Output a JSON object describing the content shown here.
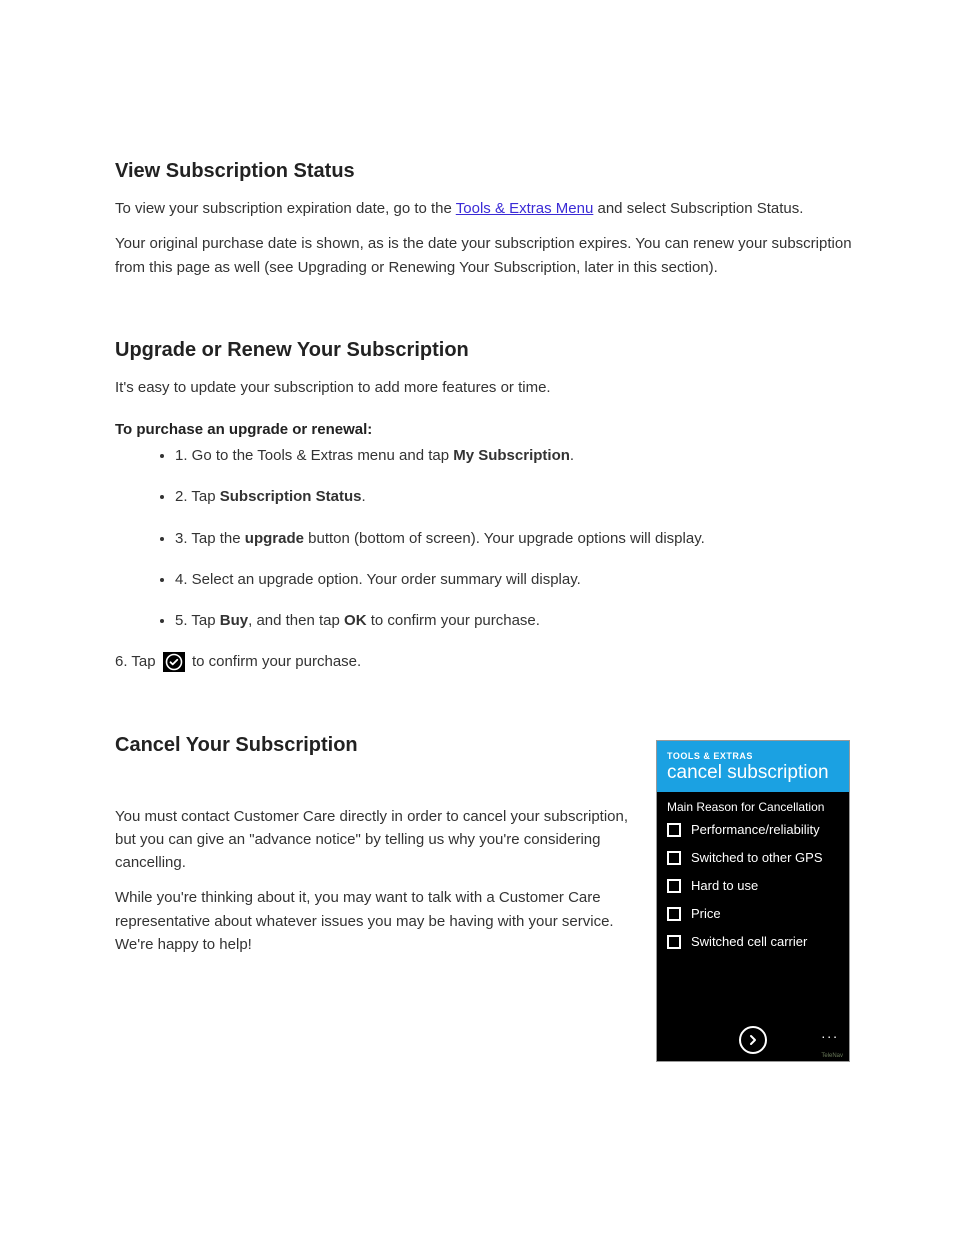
{
  "section1": {
    "heading": "View Subscription Status",
    "para1_pre": "To view your subscription expiration date, go to the ",
    "para1_link": "Tools & Extras Menu",
    "para1_post": " and select Subscription Status.",
    "para2": "Your original purchase date is shown, as is the date your subscription expires. You can renew your subscription from this page as well (see Upgrading or Renewing Your Subscription, later in this section)."
  },
  "section2": {
    "heading": "Upgrade or Renew Your Subscription",
    "para1": "It's easy to update your subscription to add more features or time.",
    "sub_heading": "To purchase an upgrade or renewal:",
    "steps": [
      {
        "pre": "1. Go to the Tools & Extras menu and tap ",
        "strong": "My Subscription",
        "post": "."
      },
      {
        "pre": "2. Tap ",
        "strong": "Subscription Status",
        "post": "."
      },
      {
        "pre": "3. Tap the ",
        "strong": "upgrade",
        "post": " button (bottom of screen). Your upgrade options will display."
      },
      {
        "pre": "4. Select an upgrade option. ",
        "strong": "",
        "post": "Your order summary will display."
      },
      {
        "pre": "5. Tap ",
        "strong": "Buy",
        "post": ", and then tap ",
        "strong2": "OK",
        "post2": " to confirm your purchase."
      }
    ],
    "after_pre": "6. Tap ",
    "after_post": " to confirm your purchase."
  },
  "section3": {
    "heading": "Cancel Your Subscription",
    "para1": "You must contact Customer Care directly in order to cancel your subscription, but you can give an \"advance notice\" by telling us why you're considering cancelling.",
    "para2": "While you're thinking about it, you may want to talk with a Customer Care representative about whatever issues you may be having with your service. We're happy to help!",
    "phone": {
      "header_crumb": "TOOLS & EXTRAS",
      "header_title": "cancel subscription",
      "prompt": "Main Reason for Cancellation",
      "options": [
        "Performance/reliability",
        "Switched to other GPS",
        "Hard to use",
        "Price",
        "Switched cell carrier"
      ],
      "dots": "...",
      "brand": "TeleNav"
    }
  }
}
